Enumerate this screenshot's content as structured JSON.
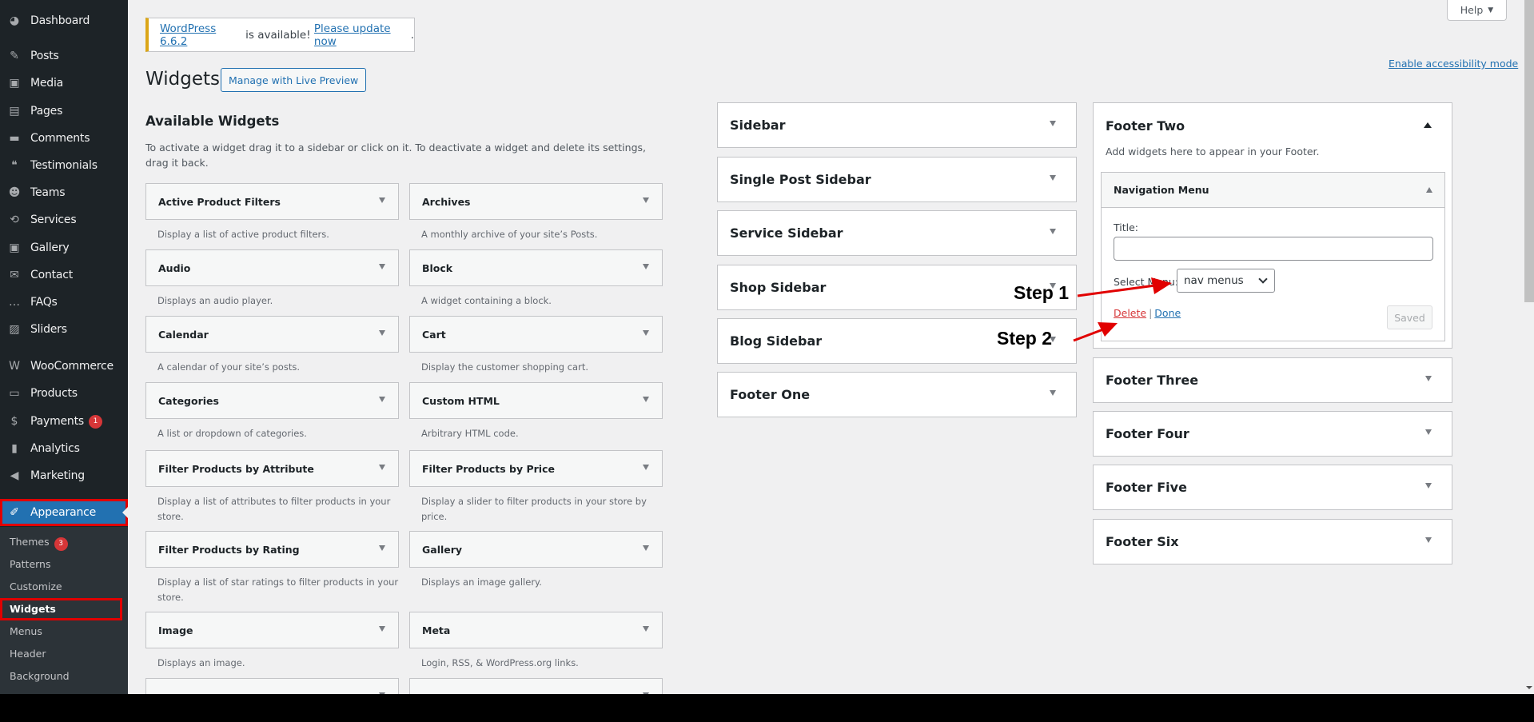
{
  "admin_menu": {
    "items": [
      {
        "label": "Dashboard",
        "icon": "dashboard-icon",
        "glyph": "◕"
      },
      {
        "label": "Posts",
        "icon": "pushpin-icon",
        "glyph": "✎"
      },
      {
        "label": "Media",
        "icon": "media-icon",
        "glyph": "▣"
      },
      {
        "label": "Pages",
        "icon": "pages-icon",
        "glyph": "▤"
      },
      {
        "label": "Comments",
        "icon": "comment-icon",
        "glyph": "▬"
      },
      {
        "label": "Testimonials",
        "icon": "testimonial-icon",
        "glyph": "❝"
      },
      {
        "label": "Teams",
        "icon": "groups-icon",
        "glyph": "☻"
      },
      {
        "label": "Services",
        "icon": "update-icon",
        "glyph": "⟲"
      },
      {
        "label": "Gallery",
        "icon": "gallery-icon",
        "glyph": "▣"
      },
      {
        "label": "Contact",
        "icon": "email-icon",
        "glyph": "✉"
      },
      {
        "label": "FAQs",
        "icon": "chat-bubble-icon",
        "glyph": "…"
      },
      {
        "label": "Sliders",
        "icon": "slides-icon",
        "glyph": "▨"
      },
      {
        "label": "WooCommerce",
        "icon": "woocommerce-icon",
        "glyph": "W"
      },
      {
        "label": "Products",
        "icon": "archive-box-icon",
        "glyph": "▭"
      },
      {
        "label": "Payments",
        "icon": "dollar-icon",
        "glyph": "$",
        "badge": "1"
      },
      {
        "label": "Analytics",
        "icon": "bar-chart-icon",
        "glyph": "▮"
      },
      {
        "label": "Marketing",
        "icon": "megaphone-icon",
        "glyph": "◀"
      },
      {
        "label": "Appearance",
        "icon": "paintbrush-icon",
        "glyph": "✐"
      }
    ],
    "submenu": [
      {
        "label": "Themes",
        "badge": "3"
      },
      {
        "label": "Patterns"
      },
      {
        "label": "Customize"
      },
      {
        "label": "Widgets"
      },
      {
        "label": "Menus"
      },
      {
        "label": "Header"
      },
      {
        "label": "Background"
      }
    ]
  },
  "header": {
    "help_label": "Help",
    "accessibility_link": "Enable accessibility mode",
    "notice": {
      "version_link": "WordPress 6.6.2",
      "middle_text": " is available! ",
      "update_link": "Please update now",
      "end": "."
    },
    "page_title": "Widgets",
    "live_preview_button": "Manage with Live Preview"
  },
  "available_widgets": {
    "title": "Available Widgets",
    "description": "To activate a widget drag it to a sidebar or click on it. To deactivate a widget and delete its settings, drag it back.",
    "widgets": [
      {
        "name": "Active Product Filters",
        "desc": "Display a list of active product filters."
      },
      {
        "name": "Archives",
        "desc": "A monthly archive of your site’s Posts."
      },
      {
        "name": "Audio",
        "desc": "Displays an audio player."
      },
      {
        "name": "Block",
        "desc": "A widget containing a block."
      },
      {
        "name": "Calendar",
        "desc": "A calendar of your site’s posts."
      },
      {
        "name": "Cart",
        "desc": "Display the customer shopping cart."
      },
      {
        "name": "Categories",
        "desc": "A list or dropdown of categories."
      },
      {
        "name": "Custom HTML",
        "desc": "Arbitrary HTML code."
      },
      {
        "name": "Filter Products by Attribute",
        "desc": "Display a list of attributes to filter products in your store."
      },
      {
        "name": "Filter Products by Price",
        "desc": "Display a slider to filter products in your store by price."
      },
      {
        "name": "Filter Products by Rating",
        "desc": "Display a list of star ratings to filter products in your store."
      },
      {
        "name": "Gallery",
        "desc": "Displays an image gallery."
      },
      {
        "name": "Image",
        "desc": "Displays an image."
      },
      {
        "name": "Meta",
        "desc": "Login, RSS, & WordPress.org links."
      },
      {
        "name": "",
        "desc": ""
      },
      {
        "name": "",
        "desc": ""
      }
    ]
  },
  "sidebars_left": [
    {
      "name": "Sidebar"
    },
    {
      "name": "Single Post Sidebar"
    },
    {
      "name": "Service Sidebar"
    },
    {
      "name": "Shop Sidebar"
    },
    {
      "name": "Blog Sidebar"
    },
    {
      "name": "Footer One"
    }
  ],
  "footer_two": {
    "title": "Footer Two",
    "description": "Add widgets here to appear in your Footer.",
    "widget": {
      "title": "Navigation Menu",
      "title_field_label": "Title:",
      "title_field_value": "",
      "select_menu_label": "Select Menu:",
      "select_menu_value": "nav menus",
      "delete_label": "Delete",
      "separator": "|",
      "done_label": "Done",
      "saved_label": "Saved"
    }
  },
  "sidebars_right": [
    {
      "name": "Footer Three"
    },
    {
      "name": "Footer Four"
    },
    {
      "name": "Footer Five"
    },
    {
      "name": "Footer Six"
    }
  ],
  "annotations": {
    "step1": "Step 1",
    "step2": "Step 2",
    "color": "#e10000"
  }
}
